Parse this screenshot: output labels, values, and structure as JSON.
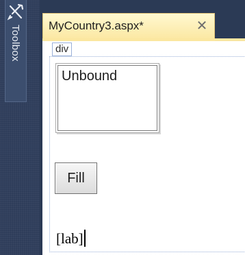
{
  "toolbox": {
    "label": "Toolbox",
    "icon": "toolbox-icon"
  },
  "document_tab": {
    "title": "MyCountry3.aspx*",
    "close_glyph": "✕",
    "close_icon": "close-icon"
  },
  "design_surface": {
    "div_tag": "div",
    "listbox": {
      "text": "Unbound"
    },
    "fill_button": {
      "label": "Fill"
    },
    "label_control": {
      "text": "[lab]"
    }
  },
  "colors": {
    "toolbox_background": "#2e3d5a",
    "tab_background": "#fbe7a0",
    "surface_background": "#ffffff",
    "outline": "#9ab0d8"
  }
}
